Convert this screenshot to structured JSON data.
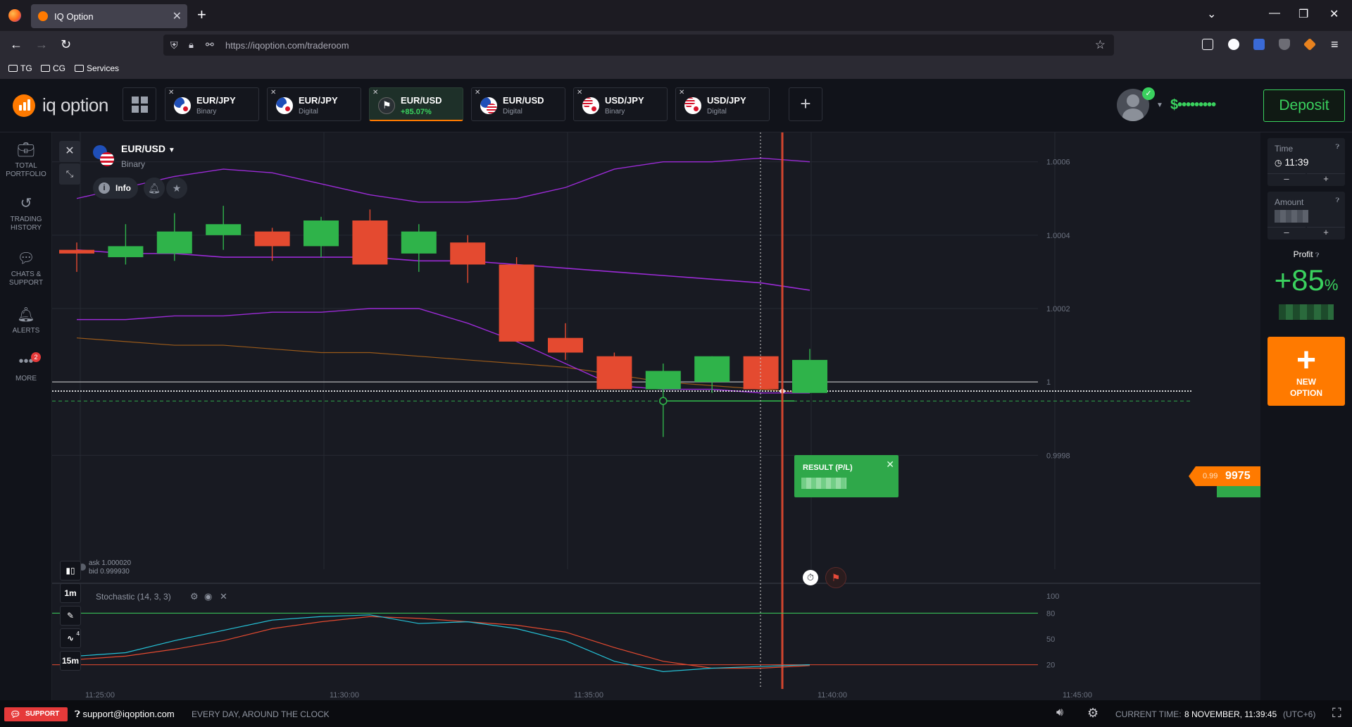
{
  "browser": {
    "tab_title": "IQ Option",
    "url": "https://iqoption.com/traderoom",
    "bookmarks": [
      "TG",
      "CG",
      "Services"
    ]
  },
  "header": {
    "logo_text": "iq option",
    "asset_tabs": [
      {
        "name": "EUR/JPY",
        "sub": "Binary",
        "flags": [
          "eu",
          "jp"
        ],
        "active": false
      },
      {
        "name": "EUR/JPY",
        "sub": "Digital",
        "flags": [
          "eu",
          "jp"
        ],
        "active": false
      },
      {
        "name": "EUR/USD",
        "sub": "+85.07%",
        "flags": [
          "flag"
        ],
        "active": true
      },
      {
        "name": "EUR/USD",
        "sub": "Digital",
        "flags": [
          "eu",
          "us"
        ],
        "active": false
      },
      {
        "name": "USD/JPY",
        "sub": "Binary",
        "flags": [
          "us",
          "jp"
        ],
        "active": false
      },
      {
        "name": "USD/JPY",
        "sub": "Digital",
        "flags": [
          "us",
          "jp"
        ],
        "active": false
      }
    ],
    "balance": "$•••••••••",
    "deposit_label": "Deposit"
  },
  "sidebar": {
    "items": [
      {
        "icon": "briefcase-icon",
        "label_1": "TOTAL",
        "label_2": "PORTFOLIO"
      },
      {
        "icon": "history-icon",
        "label_1": "TRADING",
        "label_2": "HISTORY"
      },
      {
        "icon": "chat-icon",
        "label_1": "CHATS &",
        "label_2": "SUPPORT"
      },
      {
        "icon": "bell-icon",
        "label_1": "ALERTS",
        "label_2": ""
      },
      {
        "icon": "more-icon",
        "label_1": "MORE",
        "label_2": ""
      }
    ],
    "more_badge": "2"
  },
  "chart": {
    "asset_name": "EUR/USD",
    "asset_type": "Binary",
    "info_label": "Info",
    "ask": "ask 1.000020",
    "bid": "bid 0.999930",
    "stochastic_label": "Stochastic (14, 3, 3)",
    "result_label": "RESULT (P/L)",
    "price_small": "0.99",
    "price_big": "9975",
    "timeframes": [
      "1m",
      "15m"
    ],
    "indicator_count": "4",
    "colors": {
      "up": "#2fb34a",
      "down": "#e44a30",
      "accent": "#ff7a00",
      "band": "#9b2bd6"
    }
  },
  "chart_data": {
    "type": "candlestick",
    "y_ticks": [
      "1.0006",
      "1.0004",
      "1.0002",
      "1",
      "0.9998"
    ],
    "x_ticks": [
      "11:25:00",
      "11:30:00",
      "11:35:00",
      "11:40:00",
      "11:45:00"
    ],
    "ylim": [
      0.99972,
      1.00068
    ],
    "stochastic_ticks": [
      "100",
      "80",
      "50",
      "20"
    ],
    "candles": [
      {
        "o": 1.00036,
        "h": 1.00038,
        "l": 1.0003,
        "c": 1.00035
      },
      {
        "o": 1.00034,
        "h": 1.00043,
        "l": 1.00032,
        "c": 1.00037
      },
      {
        "o": 1.00035,
        "h": 1.00046,
        "l": 1.00033,
        "c": 1.00041
      },
      {
        "o": 1.0004,
        "h": 1.00048,
        "l": 1.00036,
        "c": 1.00043
      },
      {
        "o": 1.00041,
        "h": 1.00042,
        "l": 1.00033,
        "c": 1.00037
      },
      {
        "o": 1.00037,
        "h": 1.00045,
        "l": 1.00034,
        "c": 1.00044
      },
      {
        "o": 1.00044,
        "h": 1.00047,
        "l": 1.00033,
        "c": 1.00032
      },
      {
        "o": 1.00035,
        "h": 1.00043,
        "l": 1.0003,
        "c": 1.00041
      },
      {
        "o": 1.00038,
        "h": 1.0004,
        "l": 1.00027,
        "c": 1.00032
      },
      {
        "o": 1.00032,
        "h": 1.00034,
        "l": 1.00011,
        "c": 1.00011
      },
      {
        "o": 1.00012,
        "h": 1.00016,
        "l": 1.00006,
        "c": 1.00008
      },
      {
        "o": 1.00007,
        "h": 1.00008,
        "l": 0.99998,
        "c": 0.99998
      },
      {
        "o": 0.99998,
        "h": 1.00005,
        "l": 0.99985,
        "c": 1.00003
      },
      {
        "o": 1.0,
        "h": 1.00007,
        "l": 0.99997,
        "c": 1.00007
      },
      {
        "o": 1.00007,
        "h": 1.00007,
        "l": 0.99998,
        "c": 0.99998
      },
      {
        "o": 0.99997,
        "h": 1.00009,
        "l": 0.99997,
        "c": 1.00006
      }
    ],
    "bollinger_upper": [
      1.0005,
      1.00053,
      1.00056,
      1.00058,
      1.00057,
      1.00054,
      1.00051,
      1.00049,
      1.00049,
      1.0005,
      1.00053,
      1.00058,
      1.0006,
      1.0006,
      1.00061,
      1.0006
    ],
    "bollinger_middle": [
      1.00036,
      1.00035,
      1.00035,
      1.00034,
      1.00034,
      1.00034,
      1.00034,
      1.00033,
      1.00033,
      1.00032,
      1.00031,
      1.0003,
      1.00029,
      1.00028,
      1.00027,
      1.00025
    ],
    "bollinger_lower": [
      1.00017,
      1.00017,
      1.00018,
      1.00018,
      1.00019,
      1.00019,
      1.0002,
      1.0002,
      1.00016,
      1.00011,
      1.00005,
      0.99999,
      0.99998,
      0.99998,
      0.99997,
      0.99997
    ],
    "ma_slow": [
      1.00012,
      1.00011,
      1.0001,
      1.0001,
      1.00009,
      1.00008,
      1.00008,
      1.00007,
      1.00006,
      1.00005,
      1.00004,
      1.00002,
      1.0,
      0.99999,
      0.99998,
      0.99997
    ],
    "stoch_k": [
      30,
      34,
      48,
      60,
      72,
      76,
      78,
      68,
      70,
      62,
      48,
      24,
      12,
      16,
      18,
      20
    ],
    "stoch_d": [
      26,
      30,
      38,
      48,
      62,
      70,
      76,
      74,
      70,
      66,
      58,
      40,
      24,
      16,
      16,
      19
    ]
  },
  "right_panel": {
    "time_label": "Time",
    "time_value": "11:39",
    "amount_label": "Amount",
    "profit_label": "Profit",
    "profit_value": "+85",
    "profit_unit": "%",
    "new_option_1": "NEW",
    "new_option_2": "OPTION"
  },
  "footer": {
    "support_label": "SUPPORT",
    "support_email": "support@iqoption.com",
    "support_hours": "EVERY DAY, AROUND THE CLOCK",
    "time_label": "CURRENT TIME:",
    "time_value": "8 NOVEMBER, 11:39:45",
    "timezone": "(UTC+6)"
  }
}
